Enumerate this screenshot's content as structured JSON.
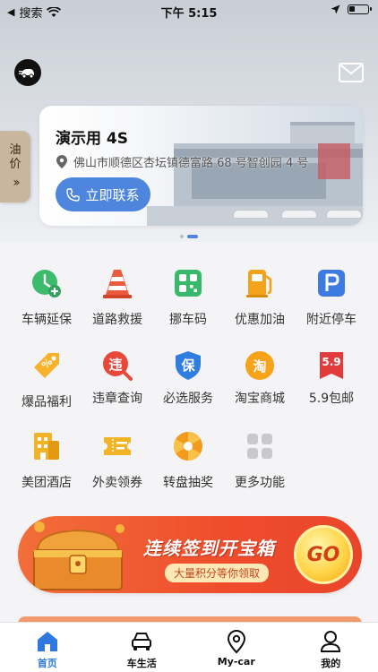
{
  "status_bar": {
    "carrier": "搜索",
    "time": "下午 5:15",
    "battery_level": 0.3
  },
  "oil_price": {
    "label_line1": "油",
    "label_line2": "价"
  },
  "banner": {
    "title": "演示用 4S",
    "address": "佛山市顺德区杏坛镇德富路 68 号智创园 4 号",
    "call_label": "立即联系",
    "page_index": 2,
    "page_count": 2
  },
  "grid": [
    {
      "label": "车辆延保",
      "icon": "clock-plus-icon",
      "color": "#3dbb6c"
    },
    {
      "label": "道路救援",
      "icon": "traffic-cone-icon",
      "color": "#ec5a3e"
    },
    {
      "label": "挪车码",
      "icon": "qr-code-icon",
      "color": "#38b86a"
    },
    {
      "label": "优惠加油",
      "icon": "fuel-pump-icon",
      "color": "#f2a31b"
    },
    {
      "label": "附近停车",
      "icon": "parking-icon",
      "color": "#3d7be0"
    },
    {
      "label": "爆品福利",
      "icon": "coupon-icon",
      "color": "#f6b22a"
    },
    {
      "label": "违章查询",
      "icon": "violation-search-icon",
      "color": "#e8483a"
    },
    {
      "label": "必选服务",
      "icon": "shield-icon",
      "color": "#2f7de0"
    },
    {
      "label": "淘宝商城",
      "icon": "taobao-icon",
      "color": "#f7a21b"
    },
    {
      "label": "5.9包邮",
      "icon": "price-tag-icon",
      "color": "#e23b3b",
      "icon_text": "5.9"
    },
    {
      "label": "美团酒店",
      "icon": "hotel-icon",
      "color": "#f2b427"
    },
    {
      "label": "外卖领券",
      "icon": "ticket-icon",
      "color": "#f2b427"
    },
    {
      "label": "转盘抽奖",
      "icon": "lottery-wheel-icon",
      "color": "#f29a1c"
    },
    {
      "label": "更多功能",
      "icon": "more-grid-icon",
      "color": "#c7c9cd"
    }
  ],
  "grid_icon_glyphs": {
    "violation": "违",
    "shield": "保",
    "taobao": "淘"
  },
  "promo": {
    "title": "连续签到开宝箱",
    "subtitle": "大量积分等你领取",
    "go_label": "GO"
  },
  "tabbar": [
    {
      "label": "首页",
      "icon": "home-icon",
      "active": true
    },
    {
      "label": "车生活",
      "icon": "car-icon",
      "active": false
    },
    {
      "label": "My-car",
      "icon": "location-pin-icon",
      "active": false
    },
    {
      "label": "我的",
      "icon": "user-icon",
      "active": false
    }
  ]
}
